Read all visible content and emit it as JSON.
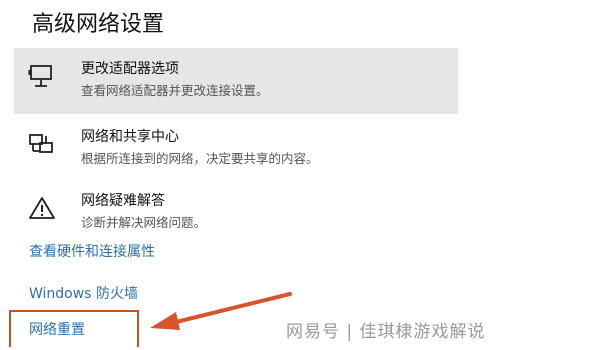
{
  "page": {
    "title": "高级网络设置"
  },
  "options": [
    {
      "icon": "network-adapter-icon",
      "title": "更改适配器选项",
      "description": "查看网络适配器并更改连接设置。",
      "highlighted": true
    },
    {
      "icon": "network-sharing-icon",
      "title": "网络和共享中心",
      "description": "根据所连接到的网络，决定要共享的内容。",
      "highlighted": false
    },
    {
      "icon": "warning-icon",
      "title": "网络疑难解答",
      "description": "诊断并解决网络问题。",
      "highlighted": false
    }
  ],
  "links": {
    "hardware_properties": "查看硬件和连接属性",
    "firewall": "Windows 防火墙",
    "network_reset": "网络重置"
  },
  "annotation": {
    "arrow_color": "#d9542a",
    "box_color": "#c4541c"
  },
  "watermark": {
    "text": "网易号 | 佳琪棣游戏解说"
  },
  "colors": {
    "link": "#2f6fad",
    "highlight_bg": "#e6e6e6"
  }
}
